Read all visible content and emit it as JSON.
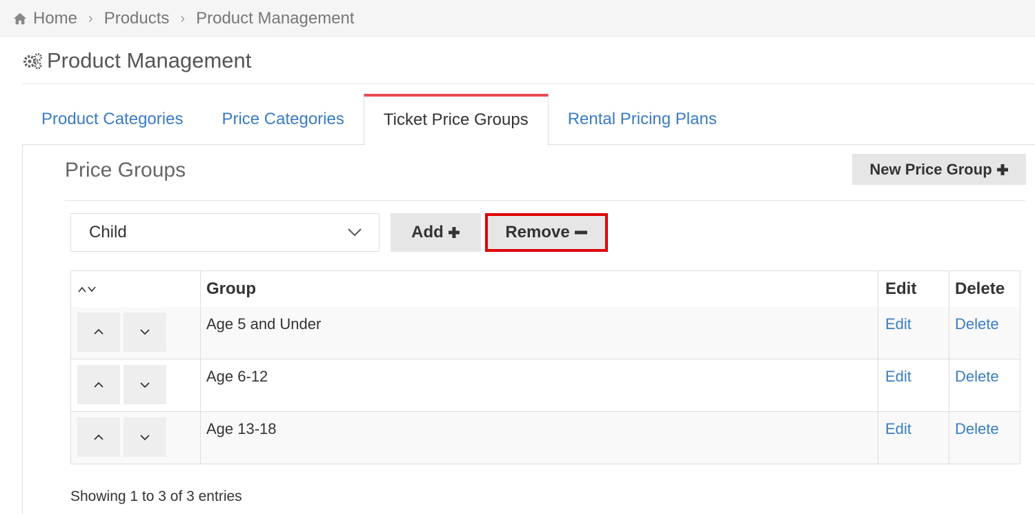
{
  "breadcrumb": {
    "items": [
      "Home",
      "Products",
      "Product Management"
    ],
    "separator": "›"
  },
  "page": {
    "title": "Product Management"
  },
  "tabs": [
    {
      "label": "Product Categories",
      "active": false
    },
    {
      "label": "Price Categories",
      "active": false
    },
    {
      "label": "Ticket Price Groups",
      "active": true
    },
    {
      "label": "Rental Pricing Plans",
      "active": false
    }
  ],
  "section": {
    "title": "Price Groups",
    "new_button_label": "New Price Group"
  },
  "controls": {
    "select_value": "Child",
    "add_label": "Add",
    "remove_label": "Remove"
  },
  "table": {
    "headers": {
      "group": "Group",
      "edit": "Edit",
      "delete": "Delete"
    },
    "rows": [
      {
        "group": "Age 5 and Under",
        "edit": "Edit",
        "delete": "Delete"
      },
      {
        "group": "Age 6-12",
        "edit": "Edit",
        "delete": "Delete"
      },
      {
        "group": "Age 13-18",
        "edit": "Edit",
        "delete": "Delete"
      }
    ]
  },
  "footer": {
    "info": "Showing 1 to 3 of 3 entries"
  },
  "colors": {
    "link": "#3a7cc1",
    "active_tab_accent": "#e94b55",
    "highlight_border": "#e00000",
    "button_bg": "#e6e6e6"
  },
  "icons": {
    "breadcrumb_home": "home-icon",
    "title": "gears-icon",
    "select": "chevron-down-icon",
    "add": "plus-icon",
    "remove": "minus-icon",
    "move_up": "chevron-up-icon",
    "move_down": "chevron-down-icon",
    "sort": "sort-icon"
  }
}
